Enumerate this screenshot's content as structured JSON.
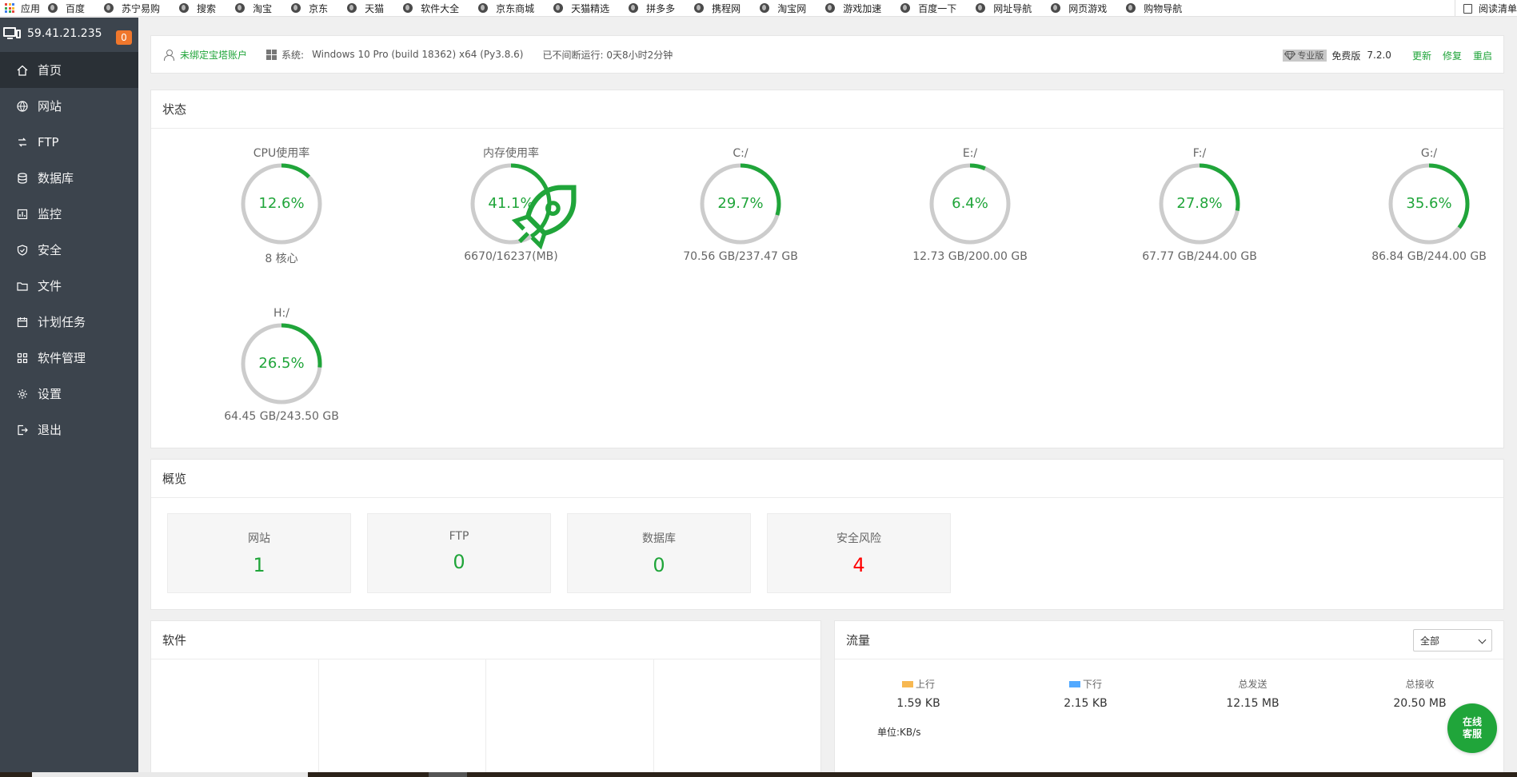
{
  "bookmarks": {
    "apps_label": "应用",
    "items": [
      "百度",
      "苏宁易购",
      "搜索",
      "淘宝",
      "京东",
      "天猫",
      "软件大全",
      "京东商城",
      "天猫精选",
      "拼多多",
      "携程网",
      "淘宝网",
      "游戏加速",
      "百度一下",
      "网址导航",
      "网页游戏",
      "购物导航"
    ],
    "reading_list": "阅读清单"
  },
  "sidebar": {
    "ip": "59.41.21.235",
    "badge": "0",
    "items": [
      {
        "label": "首页",
        "icon": "home-icon",
        "active": true
      },
      {
        "label": "网站",
        "icon": "globe-icon"
      },
      {
        "label": "FTP",
        "icon": "ftp-icon"
      },
      {
        "label": "数据库",
        "icon": "database-icon"
      },
      {
        "label": "监控",
        "icon": "monitor-chart-icon"
      },
      {
        "label": "安全",
        "icon": "shield-icon"
      },
      {
        "label": "文件",
        "icon": "folder-icon"
      },
      {
        "label": "计划任务",
        "icon": "calendar-icon"
      },
      {
        "label": "软件管理",
        "icon": "apps-icon"
      },
      {
        "label": "设置",
        "icon": "gear-icon"
      },
      {
        "label": "退出",
        "icon": "logout-icon"
      }
    ]
  },
  "topbar": {
    "bind_account": "未绑定宝塔账户",
    "system_label": "系统:",
    "system_value": "Windows 10 Pro (build 18362) x64 (Py3.8.6)",
    "runtime": "已不间断运行: 0天8小时2分钟",
    "pro_label": "专业版",
    "free_label": "免费版",
    "version": "7.2.0",
    "update": "更新",
    "repair": "修复",
    "restart": "重启"
  },
  "status": {
    "title": "状态",
    "gauges": [
      {
        "label": "CPU使用率",
        "percent": 12.6,
        "pct_text": "12.6%",
        "sub": "8 核心"
      },
      {
        "label": "内存使用率",
        "percent": 41.1,
        "pct_text": "41.1%",
        "sub": "6670/16237(MB)",
        "rocket": true
      },
      {
        "label": "C:/",
        "percent": 29.7,
        "pct_text": "29.7%",
        "sub": "70.56 GB/237.47 GB"
      },
      {
        "label": "E:/",
        "percent": 6.4,
        "pct_text": "6.4%",
        "sub": "12.73 GB/200.00 GB"
      },
      {
        "label": "F:/",
        "percent": 27.8,
        "pct_text": "27.8%",
        "sub": "67.77 GB/244.00 GB"
      },
      {
        "label": "G:/",
        "percent": 35.6,
        "pct_text": "35.6%",
        "sub": "86.84 GB/244.00 GB"
      },
      {
        "label": "H:/",
        "percent": 26.5,
        "pct_text": "26.5%",
        "sub": "64.45 GB/243.50 GB"
      }
    ]
  },
  "overview": {
    "title": "概览",
    "items": [
      {
        "label": "网站",
        "value": "1"
      },
      {
        "label": "FTP",
        "value": "0"
      },
      {
        "label": "数据库",
        "value": "0"
      },
      {
        "label": "安全风险",
        "value": "4",
        "danger": true
      }
    ]
  },
  "software": {
    "title": "软件"
  },
  "traffic": {
    "title": "流量",
    "select_value": "全部",
    "stats": [
      {
        "label": "上行",
        "value": "1.59 KB",
        "swatch": "#f7b851"
      },
      {
        "label": "下行",
        "value": "2.15 KB",
        "swatch": "#52a9ff"
      },
      {
        "label": "总发送",
        "value": "12.15 MB"
      },
      {
        "label": "总接收",
        "value": "20.50 MB"
      }
    ],
    "unit": "单位:KB/s"
  },
  "chat": {
    "line1": "在线",
    "line2": "客服"
  },
  "colors": {
    "accent": "#20a53a",
    "danger": "#ff0000",
    "sidebar": "#3c444d",
    "badge": "#f0772c",
    "ring_track": "#cccccc"
  }
}
